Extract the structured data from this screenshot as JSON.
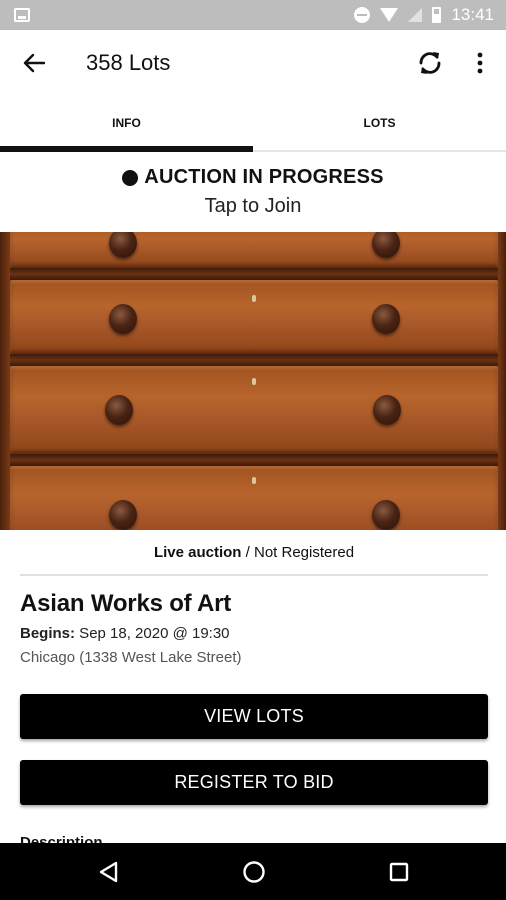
{
  "status_bar": {
    "time": "13:41",
    "icons": [
      "notification-icon",
      "do-not-disturb-icon",
      "wifi-icon",
      "signal-icon",
      "battery-icon"
    ]
  },
  "app_bar": {
    "title": "358 Lots",
    "icons": [
      "back-arrow-icon",
      "refresh-icon",
      "more-vert-icon"
    ]
  },
  "tabs": [
    {
      "label": "INFO",
      "active": true
    },
    {
      "label": "LOTS",
      "active": false
    }
  ],
  "banner": {
    "status": "AUCTION IN PROGRESS",
    "subtitle": "Tap to Join"
  },
  "auction": {
    "type": "Live auction",
    "registration": " / Not Registered",
    "title": "Asian Works of Art",
    "begins_label": "Begins:",
    "begins_value": " Sep 18, 2020 @ 19:30",
    "location": "Chicago (1338 West Lake Street)"
  },
  "buttons": {
    "view_lots": "VIEW LOTS",
    "register": "REGISTER TO BID"
  },
  "description_label": "Description",
  "nav_bar": {
    "icons": [
      "back-triangle-icon",
      "home-circle-icon",
      "recents-square-icon"
    ]
  },
  "colors": {
    "primary": "#000000",
    "status_bar": "#bdbdbd",
    "divider": "#e0e0e0"
  }
}
